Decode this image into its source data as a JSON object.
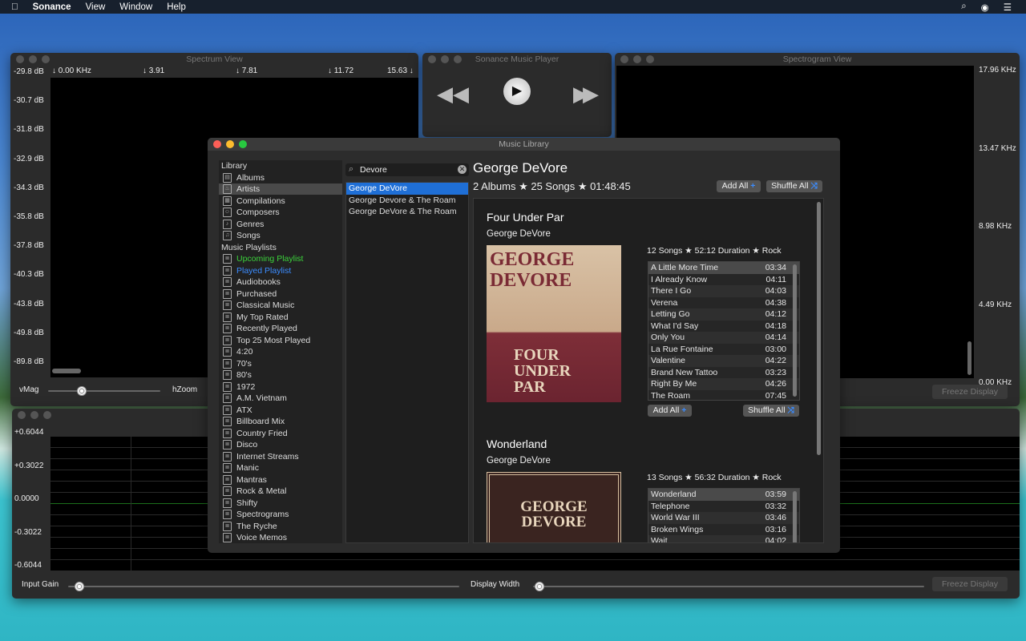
{
  "menubar": {
    "apple": "",
    "app": "Sonance",
    "items": [
      "View",
      "Window",
      "Help"
    ]
  },
  "spectrum": {
    "title": "Spectrum View",
    "freq_labels": [
      "↓ 0.00 KHz",
      "↓ 3.91",
      "↓ 7.81",
      "↓ 11.72",
      "15.63 ↓"
    ],
    "db_labels": [
      "-29.8 dB",
      "-30.7 dB",
      "-31.8 dB",
      "-32.9 dB",
      "-34.3 dB",
      "-35.8 dB",
      "-37.8 dB",
      "-40.3 dB",
      "-43.8 dB",
      "-49.8 dB",
      "-89.8 dB"
    ],
    "vmag_label": "vMag",
    "hzoom_label": "hZoom",
    "vmag_value": 0.35
  },
  "player": {
    "title": "Sonance Music Player"
  },
  "spectrogram": {
    "title": "Spectrogram View",
    "freq_labels": [
      "17.96 KHz",
      "13.47 KHz",
      "8.98 KHz",
      "4.49 KHz",
      "0.00 KHz"
    ],
    "freeze_label": "Freeze Display"
  },
  "scope": {
    "amp_labels": [
      "+0.6044",
      "+0.3022",
      "0.0000",
      "-0.3022",
      "-0.6044"
    ],
    "input_gain_label": "Input Gain",
    "display_width_label": "Display Width",
    "freeze_label": "Freeze Display",
    "input_gain_value": 0.03,
    "display_width_value": 0.02
  },
  "library": {
    "title": "Music Library",
    "sidebar": [
      {
        "label": "Library",
        "head": true
      },
      {
        "label": "Albums",
        "icon": "album"
      },
      {
        "label": "Artists",
        "icon": "mic",
        "selected": true
      },
      {
        "label": "Compilations",
        "icon": "grid"
      },
      {
        "label": "Composers",
        "icon": "person"
      },
      {
        "label": "Genres",
        "icon": "guitar"
      },
      {
        "label": "Songs",
        "icon": "note"
      },
      {
        "label": "Music Playlists",
        "head": true
      },
      {
        "label": "Upcoming Playlist",
        "icon": "playlist",
        "color": "#3bd23b"
      },
      {
        "label": "Played Playlist",
        "icon": "playlist",
        "color": "#3b8cff"
      },
      {
        "label": "Audiobooks",
        "icon": "playlist"
      },
      {
        "label": "Purchased",
        "icon": "playlist"
      },
      {
        "label": "Classical Music",
        "icon": "playlist"
      },
      {
        "label": "My Top Rated",
        "icon": "playlist"
      },
      {
        "label": "Recently Played",
        "icon": "playlist"
      },
      {
        "label": "Top 25 Most Played",
        "icon": "playlist"
      },
      {
        "label": "4:20",
        "icon": "playlist"
      },
      {
        "label": "70's",
        "icon": "playlist"
      },
      {
        "label": "80's",
        "icon": "playlist"
      },
      {
        "label": "1972",
        "icon": "playlist"
      },
      {
        "label": "A.M. Vietnam",
        "icon": "playlist"
      },
      {
        "label": "ATX",
        "icon": "playlist"
      },
      {
        "label": "Billboard Mix",
        "icon": "playlist"
      },
      {
        "label": "Country Fried",
        "icon": "playlist"
      },
      {
        "label": "Disco",
        "icon": "playlist"
      },
      {
        "label": "Internet Streams",
        "icon": "playlist"
      },
      {
        "label": "Manic",
        "icon": "playlist"
      },
      {
        "label": "Mantras",
        "icon": "playlist"
      },
      {
        "label": "Rock & Metal",
        "icon": "playlist"
      },
      {
        "label": "Shifty",
        "icon": "playlist"
      },
      {
        "label": "Spectrograms",
        "icon": "playlist"
      },
      {
        "label": "The Ryche",
        "icon": "playlist"
      },
      {
        "label": "Voice Memos",
        "icon": "playlist"
      }
    ],
    "search": {
      "value": "Devore",
      "results": [
        "George DeVore",
        "George Devore & The Roam",
        "George DeVore & The Roam"
      ]
    },
    "artist": {
      "name": "George DeVore",
      "summary": "2 Albums ★ 25 Songs ★ 01:48:45",
      "add_all": "Add All",
      "shuffle_all": "Shuffle All"
    },
    "albums": [
      {
        "title": "Four Under Par",
        "artist": "George DeVore",
        "meta": "12 Songs ★ 52:12 Duration ★ Rock",
        "art_text": [
          "GEORGE",
          "DEVORE",
          "FOUR",
          "UNDER",
          "PAR"
        ],
        "add_all": "Add All",
        "shuffle_all": "Shuffle All",
        "tracks": [
          [
            "A Little More Time",
            "03:34"
          ],
          [
            "I Already Know",
            "04:11"
          ],
          [
            "There I Go",
            "04:03"
          ],
          [
            "Verena",
            "04:38"
          ],
          [
            "Letting Go",
            "04:12"
          ],
          [
            "What I'd Say",
            "04:18"
          ],
          [
            "Only You",
            "04:14"
          ],
          [
            "La Rue Fontaine",
            "03:00"
          ],
          [
            "Valentine",
            "04:22"
          ],
          [
            "Brand New Tattoo",
            "03:23"
          ],
          [
            "Right By Me",
            "04:26"
          ],
          [
            "The Roam",
            "07:45"
          ]
        ]
      },
      {
        "title": "Wonderland",
        "artist": "George DeVore",
        "meta": "13 Songs ★ 56:32 Duration ★ Rock",
        "art_text": [
          "GEORGE",
          "DEVORE"
        ],
        "tracks": [
          [
            "Wonderland",
            "03:59"
          ],
          [
            "Telephone",
            "03:32"
          ],
          [
            "World War III",
            "03:46"
          ],
          [
            "Broken Wings",
            "03:16"
          ],
          [
            "Wait",
            "04:02"
          ]
        ]
      }
    ]
  },
  "colors": {
    "accent": "#1f6fd6",
    "upcoming": "#3bd23b",
    "played": "#3b8cff"
  }
}
